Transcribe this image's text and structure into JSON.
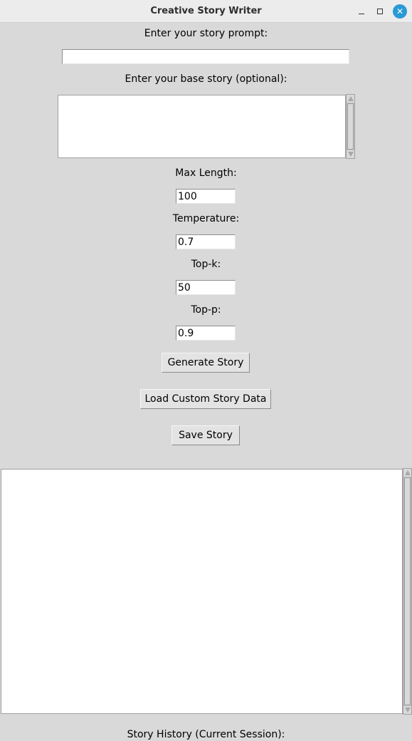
{
  "window": {
    "title": "Creative Story Writer",
    "minimize_icon": "minimize-icon",
    "maximize_icon": "maximize-icon",
    "close_icon": "close-icon",
    "close_glyph": "✕",
    "accent_color": "#2a9ad6"
  },
  "prompt": {
    "label": "Enter your story prompt:",
    "value": ""
  },
  "base_story": {
    "label": "Enter your base story (optional):",
    "value": ""
  },
  "params": {
    "max_length": {
      "label": "Max Length:",
      "value": "100"
    },
    "temperature": {
      "label": "Temperature:",
      "value": "0.7"
    },
    "top_k": {
      "label": "Top-k:",
      "value": "50"
    },
    "top_p": {
      "label": "Top-p:",
      "value": "0.9"
    }
  },
  "actions": {
    "generate_label": "Generate Story",
    "load_label": "Load Custom Story Data",
    "save_label": "Save Story"
  },
  "output": {
    "value": ""
  },
  "history": {
    "label": "Story History (Current Session):"
  }
}
